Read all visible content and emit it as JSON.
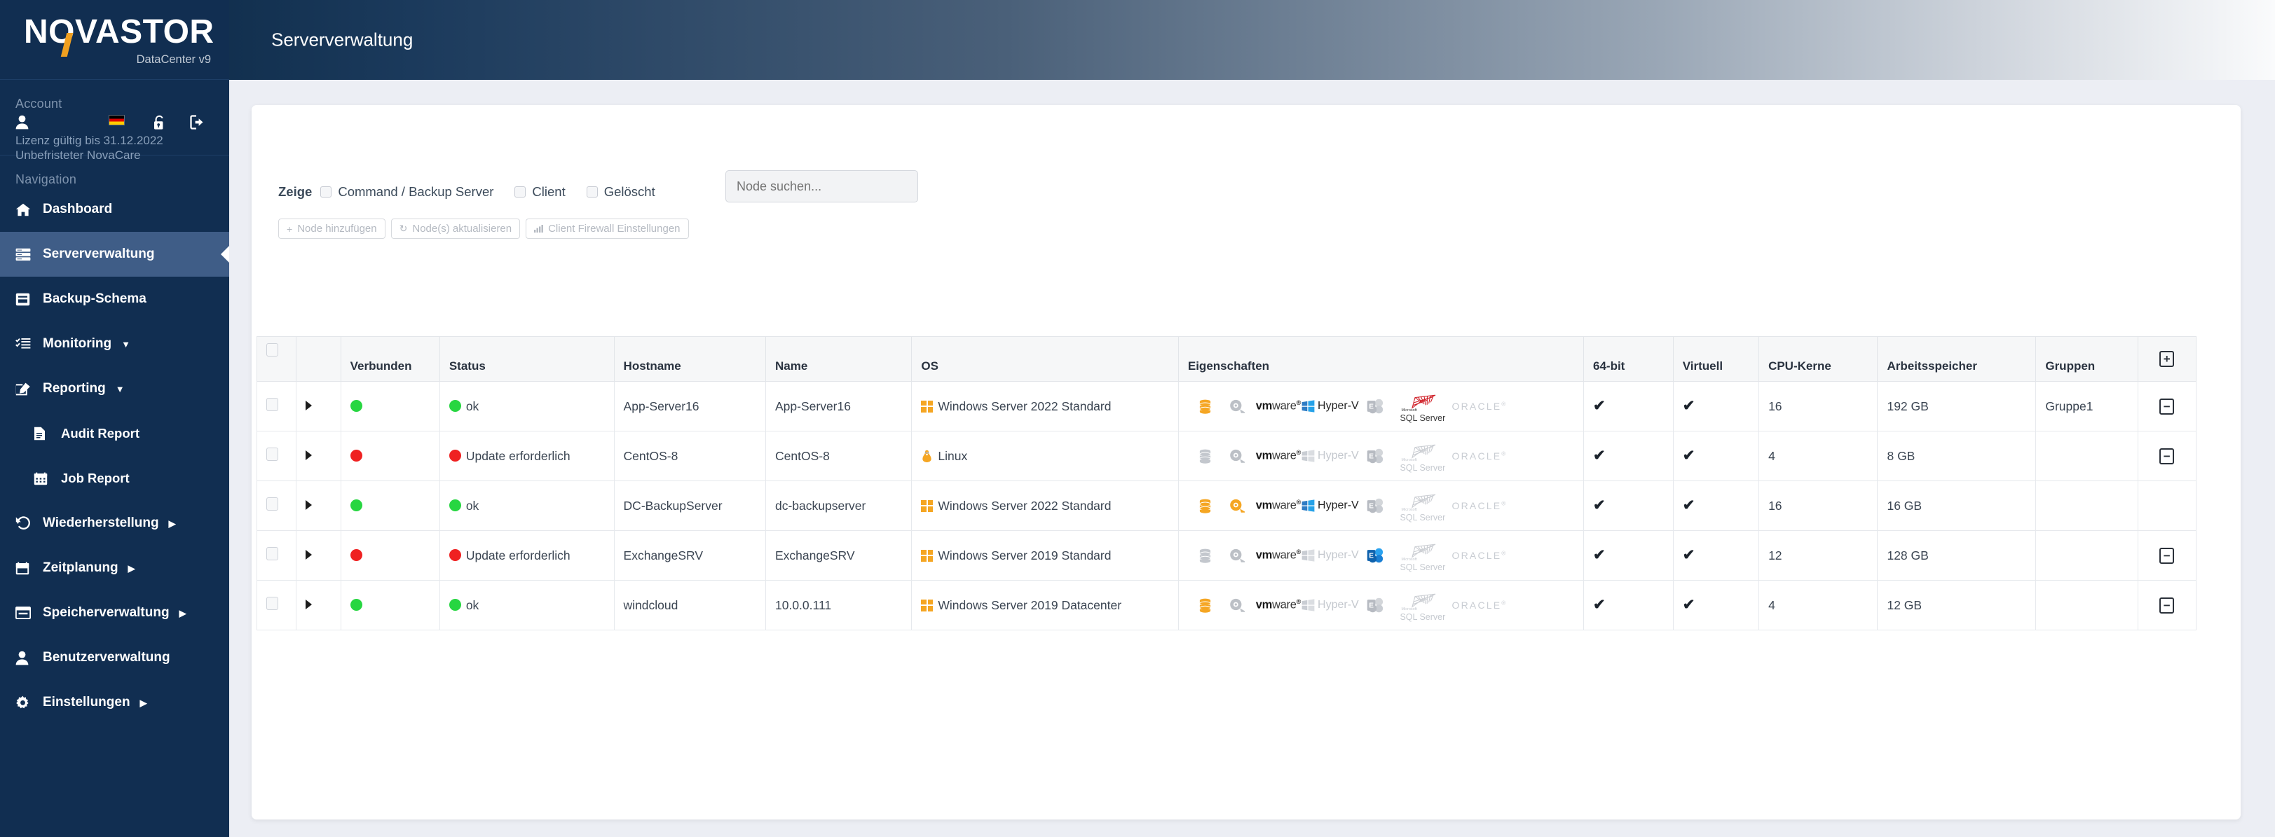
{
  "brand": {
    "logo": "NOVASTOR",
    "subtitle": "DataCenter v9"
  },
  "sidebar": {
    "account_label": "Account",
    "account_icons": [
      {
        "name": "user-icon",
        "glyph": "👤"
      },
      {
        "name": "german-flag-icon",
        "glyph": ""
      },
      {
        "name": "unlock-icon",
        "glyph": "🔓"
      },
      {
        "name": "logout-icon",
        "glyph": "↪"
      }
    ],
    "license_line1": "Lizenz gültig bis 31.12.2022",
    "license_line2": "Unbefristeter NovaCare",
    "navigation_label": "Navigation",
    "items": [
      {
        "label": "Dashboard",
        "icon": "home-icon",
        "active": false,
        "caret": "",
        "sub": false
      },
      {
        "label": "Serververwaltung",
        "icon": "server-icon",
        "active": true,
        "caret": "",
        "sub": false
      },
      {
        "label": "Backup-Schema",
        "icon": "archive-icon",
        "active": false,
        "caret": "",
        "sub": false
      },
      {
        "label": "Monitoring",
        "icon": "tasklist-icon",
        "active": false,
        "caret": "",
        "sub": false
      },
      {
        "label": "Reporting",
        "icon": "edit-icon",
        "active": false,
        "caret": "▼",
        "sub": false
      },
      {
        "label": "Audit Report",
        "icon": "document-icon",
        "active": false,
        "caret": "",
        "sub": true
      },
      {
        "label": "Job Report",
        "icon": "calendar-icon",
        "active": false,
        "caret": "",
        "sub": true
      },
      {
        "label": "Wiederherstellung",
        "icon": "undo-icon",
        "active": false,
        "caret": "▶",
        "sub": false
      },
      {
        "label": "Zeitplanung",
        "icon": "calendar2-icon",
        "active": false,
        "caret": "▶",
        "sub": false
      },
      {
        "label": "Speicherverwaltung",
        "icon": "storage-icon",
        "active": false,
        "caret": "▶",
        "sub": false
      },
      {
        "label": "Benutzerverwaltung",
        "icon": "users-icon",
        "active": false,
        "caret": "",
        "sub": false
      },
      {
        "label": "Einstellungen",
        "icon": "gear-icon",
        "active": false,
        "caret": "▶",
        "sub": false
      }
    ]
  },
  "topbar": {
    "title": "Serververwaltung"
  },
  "toolbar": {
    "zeige_label": "Zeige",
    "filters": [
      {
        "label": "Command / Backup Server",
        "checked": false
      },
      {
        "label": "Client",
        "checked": false
      },
      {
        "label": "Gelöscht",
        "checked": false
      }
    ],
    "search_placeholder": "Node suchen...",
    "search_value": "",
    "buttons": [
      {
        "label": "Node hinzufügen",
        "icon": "plus-icon",
        "glyph": "+",
        "disabled": true
      },
      {
        "label": "Node(s) aktualisieren",
        "icon": "refresh-icon",
        "glyph": "↻",
        "disabled": true
      },
      {
        "label": "Client Firewall Einstellungen",
        "icon": "bars-icon",
        "glyph": "▃",
        "disabled": true
      }
    ]
  },
  "table": {
    "headers": {
      "select": "",
      "expand": "",
      "connected": "Verbunden",
      "status": "Status",
      "hostname": "Hostname",
      "name": "Name",
      "os": "OS",
      "properties": "Eigenschaften",
      "bits": "64-bit",
      "virtual": "Virtuell",
      "cpu": "CPU-Kerne",
      "memory": "Arbeitsspeicher",
      "groups": "Gruppen",
      "action": "add-column-icon"
    },
    "header_action_glyph": "+",
    "row_action_glyph": "−",
    "property_names": [
      "database-icon",
      "magnifier-icon",
      "vmware-logo",
      "hyperv-logo",
      "exchange-logo",
      "sqlserver-logo",
      "oracle-logo"
    ],
    "property_labels": {
      "vmware": "vmware",
      "vmware_bold": "vm",
      "vmware_light": "ware",
      "hyperv": "Hyper-V",
      "exchange": "E",
      "sql_ms": "Microsoft",
      "sql_name": "SQL Server",
      "oracle": "ORACLE"
    },
    "rows": [
      {
        "connected": "green",
        "status_dot": "green",
        "status": "ok",
        "hostname": "App-Server16",
        "name": "App-Server16",
        "os": "Windows Server 2022 Standard",
        "os_icon": "windows-icon",
        "props": {
          "database": "orange",
          "magnifier": "gray",
          "vmware": "dark",
          "hyperv": "color",
          "exchange": "gray",
          "sqlserver": "color",
          "oracle": "gray"
        },
        "bits": "✔",
        "virtual": "✔",
        "cpu": "16",
        "memory": "192 GB",
        "groups": "Gruppe1",
        "action": true
      },
      {
        "connected": "red",
        "status_dot": "red",
        "status": "Update erforderlich",
        "hostname": "CentOS-8",
        "name": "CentOS-8",
        "os": "Linux",
        "os_icon": "linux-icon",
        "props": {
          "database": "gray",
          "magnifier": "gray",
          "vmware": "dark",
          "hyperv": "gray",
          "exchange": "gray",
          "sqlserver": "gray",
          "oracle": "gray"
        },
        "bits": "✔",
        "virtual": "✔",
        "cpu": "4",
        "memory": "8 GB",
        "groups": "",
        "action": true
      },
      {
        "connected": "green",
        "status_dot": "green",
        "status": "ok",
        "hostname": "DC-BackupServer",
        "name": "dc-backupserver",
        "os": "Windows Server 2022 Standard",
        "os_icon": "windows-icon",
        "props": {
          "database": "orange",
          "magnifier": "orange",
          "vmware": "dark",
          "hyperv": "color",
          "exchange": "gray",
          "sqlserver": "gray",
          "oracle": "gray"
        },
        "bits": "✔",
        "virtual": "✔",
        "cpu": "16",
        "memory": "16 GB",
        "groups": "",
        "action": false
      },
      {
        "connected": "red",
        "status_dot": "red",
        "status": "Update erforderlich",
        "hostname": "ExchangeSRV",
        "name": "ExchangeSRV",
        "os": "Windows Server 2019 Standard",
        "os_icon": "windows-icon",
        "props": {
          "database": "gray",
          "magnifier": "gray",
          "vmware": "dark",
          "hyperv": "gray",
          "exchange": "color",
          "sqlserver": "gray",
          "oracle": "gray"
        },
        "bits": "✔",
        "virtual": "✔",
        "cpu": "12",
        "memory": "128 GB",
        "groups": "",
        "action": true
      },
      {
        "connected": "green",
        "status_dot": "green",
        "status": "ok",
        "hostname": "windcloud",
        "name": "10.0.0.111",
        "os": "Windows Server 2019 Datacenter",
        "os_icon": "windows-icon",
        "props": {
          "database": "orange",
          "magnifier": "gray",
          "vmware": "dark",
          "hyperv": "gray",
          "exchange": "gray",
          "sqlserver": "gray",
          "oracle": "gray"
        },
        "bits": "✔",
        "virtual": "✔",
        "cpu": "4",
        "memory": "12 GB",
        "groups": "",
        "action": true
      }
    ]
  },
  "colors": {
    "sidebar_bg": "#112e51",
    "sidebar_active": "#3f5d87",
    "accent_orange": "#f0a020",
    "status_green": "#27d641",
    "status_red": "#ef2121",
    "page_bg": "#eceef4"
  }
}
